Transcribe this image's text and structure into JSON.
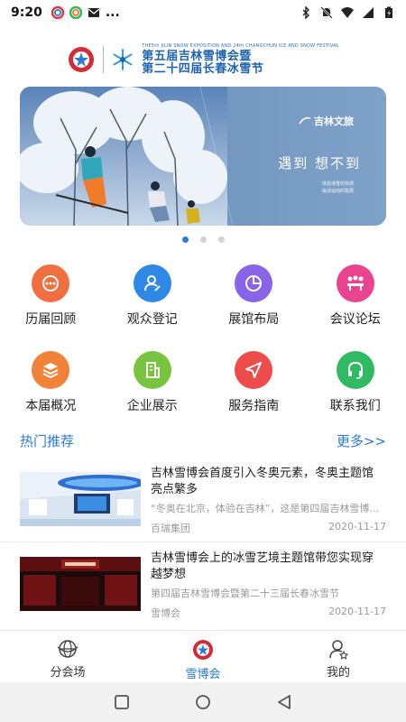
{
  "status_bar": {
    "time": "9:20",
    "more": "..."
  },
  "header": {
    "title_en": "THE5th JILIN SNOW EXPOSITION AND 24th CHANGCHUN ICE AND SNOW FESTIVAL",
    "title_line1": "第五届吉林雪博会暨",
    "title_line2": "第二十四届长春冰雪节"
  },
  "banner": {
    "brand": "吉林文旅",
    "slogan": "遇到 想不到",
    "sub1": "体验滑雪的快感",
    "sub2": "挑战运动的极限",
    "dots": 3,
    "active_dot": 0
  },
  "grid": {
    "row1": [
      {
        "label": "历届回顾",
        "icon": "history-icon",
        "color": "#f06e3f"
      },
      {
        "label": "观众登记",
        "icon": "user-register-icon",
        "color": "#2f88e6"
      },
      {
        "label": "展馆布局",
        "icon": "pie-chart-icon",
        "color": "#8a64e8"
      },
      {
        "label": "会议论坛",
        "icon": "meeting-icon",
        "color": "#e9458e"
      }
    ],
    "row2": [
      {
        "label": "本届概况",
        "icon": "layers-icon",
        "color": "#f0823a"
      },
      {
        "label": "企业展示",
        "icon": "building-icon",
        "color": "#79c43e"
      },
      {
        "label": "服务指南",
        "icon": "navigation-icon",
        "color": "#ee4b4b"
      },
      {
        "label": "联系我们",
        "icon": "headset-icon",
        "color": "#2fba63"
      }
    ]
  },
  "section": {
    "title": "热门推荐",
    "more": "更多>>"
  },
  "news": [
    {
      "title": "吉林雪博会首度引入冬奥元素，冬奥主题馆亮点繁多",
      "summary": "“冬奥在北京，体验在吉林”，这是第四届吉林雪博会的主题",
      "source": "百瑞集团",
      "date": "2020-11-17"
    },
    {
      "title": "吉林雪博会上的冰雪艺境主题馆带您实现穿越梦想",
      "summary": "第四届吉林雪博会暨第二十三届长春冰雪节",
      "source": "雪博会",
      "date": "2020-11-17"
    }
  ],
  "tabs": [
    {
      "label": "分会场",
      "icon": "globe-icon"
    },
    {
      "label": "雪博会",
      "icon": "expo-logo-icon"
    },
    {
      "label": "我的",
      "icon": "profile-icon"
    }
  ],
  "active_tab": 1,
  "colors": {
    "accent": "#2a7ad6",
    "header_blue": "#1f63b3",
    "logo_red": "#d42b34"
  }
}
